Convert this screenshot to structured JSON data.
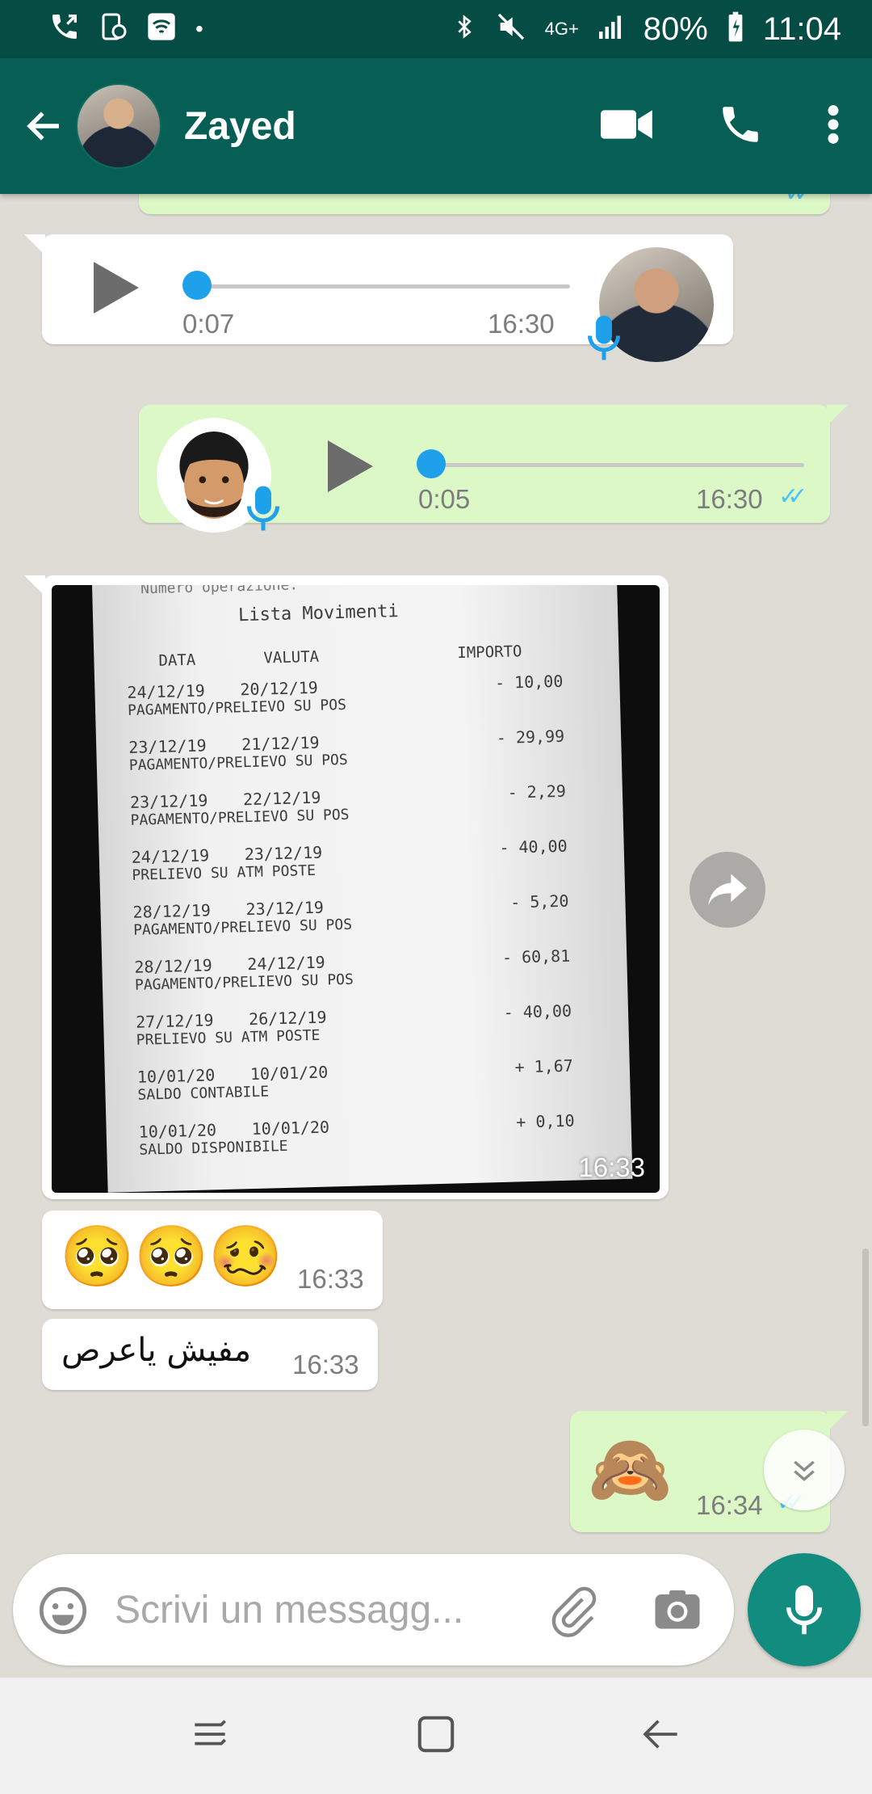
{
  "status_bar": {
    "battery": "80%",
    "time": "11:04",
    "network": "4G+"
  },
  "header": {
    "contact_name": "Zayed"
  },
  "messages": {
    "voice_in": {
      "duration": "0:07",
      "time": "16:30",
      "progress": 0
    },
    "voice_out": {
      "duration": "0:05",
      "time": "16:30",
      "progress": 0
    },
    "photo": {
      "time": "16:33",
      "receipt": {
        "title": "Lista Movimenti",
        "top_fragment": "Numero operazione:",
        "headers": [
          "DATA",
          "VALUTA",
          "IMPORTO"
        ],
        "rows": [
          {
            "date": "24/12/19",
            "value_date": "20/12/19",
            "desc": "PAGAMENTO/PRELIEVO SU POS",
            "amount": "- 10,00"
          },
          {
            "date": "23/12/19",
            "value_date": "21/12/19",
            "desc": "PAGAMENTO/PRELIEVO SU POS",
            "amount": "- 29,99"
          },
          {
            "date": "23/12/19",
            "value_date": "22/12/19",
            "desc": "PAGAMENTO/PRELIEVO SU POS",
            "amount": "- 2,29"
          },
          {
            "date": "24/12/19",
            "value_date": "23/12/19",
            "desc": "PRELIEVO SU ATM POSTE",
            "amount": "- 40,00"
          },
          {
            "date": "28/12/19",
            "value_date": "23/12/19",
            "desc": "PAGAMENTO/PRELIEVO SU POS",
            "amount": "- 5,20"
          },
          {
            "date": "28/12/19",
            "value_date": "24/12/19",
            "desc": "PAGAMENTO/PRELIEVO SU POS",
            "amount": "- 60,81"
          },
          {
            "date": "27/12/19",
            "value_date": "26/12/19",
            "desc": "PRELIEVO SU ATM POSTE",
            "amount": "- 40,00"
          },
          {
            "date": "10/01/20",
            "value_date": "10/01/20",
            "desc": "SALDO CONTABILE",
            "amount": "+ 1,67"
          },
          {
            "date": "10/01/20",
            "value_date": "10/01/20",
            "desc": "SALDO DISPONIBILE",
            "amount": "+ 0,10"
          }
        ]
      }
    },
    "emoji_in": {
      "text": "🥺🥺🥴",
      "time": "16:33"
    },
    "text_in": {
      "text": "مفيش ياعرص",
      "time": "16:33"
    },
    "emoji_out": {
      "text": "🙈",
      "time": "16:34"
    }
  },
  "composer": {
    "placeholder": "Scrivi un messagg..."
  },
  "colors": {
    "header": "#075e54",
    "status_bar": "#054d44",
    "outgoing_bubble": "#dcf8c6",
    "incoming_bubble": "#ffffff",
    "accent": "#128c7e",
    "read_ticks": "#4fc3f7"
  },
  "icons": [
    "back-arrow-icon",
    "video-call-icon",
    "phone-icon",
    "more-vert-icon",
    "play-icon",
    "mic-icon",
    "forward-icon",
    "emoji-icon",
    "attach-icon",
    "camera-icon",
    "chevron-down-icon"
  ]
}
